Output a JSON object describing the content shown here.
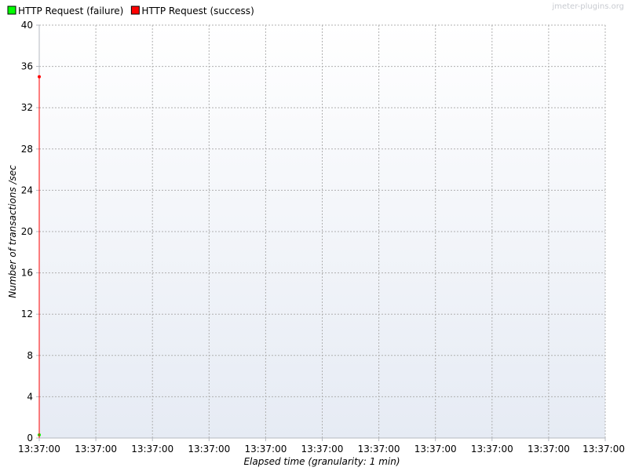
{
  "watermark": "jmeter-plugins.org",
  "chart_data": {
    "type": "line",
    "title": "",
    "xlabel": "Elapsed time (granularity: 1 min)",
    "ylabel": "Number of transactions /sec",
    "ylim": [
      0,
      40
    ],
    "yticks": [
      0,
      4,
      8,
      12,
      16,
      20,
      24,
      28,
      32,
      36,
      40
    ],
    "xticks": [
      "13:37:00",
      "13:37:00",
      "13:37:00",
      "13:37:00",
      "13:37:00",
      "13:37:00",
      "13:37:00",
      "13:37:00",
      "13:37:00",
      "13:37:00",
      "13:37:00"
    ],
    "grid": true,
    "legend_position": "top-left",
    "series": [
      {
        "name": "HTTP Request (failure)",
        "color": "#00ff00",
        "points": [
          {
            "x": "13:37:00",
            "y": 0.3
          }
        ]
      },
      {
        "name": "HTTP Request (success)",
        "color": "#ff0000",
        "points": [
          {
            "x": "13:37:00",
            "y": 0
          },
          {
            "x": "13:37:00",
            "y": 35
          }
        ]
      }
    ]
  }
}
